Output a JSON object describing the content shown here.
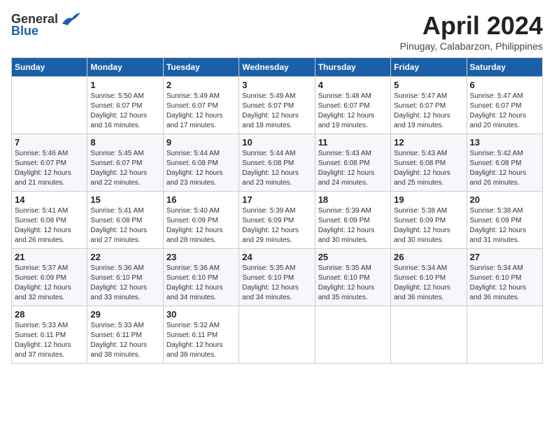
{
  "header": {
    "logo_general": "General",
    "logo_blue": "Blue",
    "month_title": "April 2024",
    "location": "Pinugay, Calabarzon, Philippines"
  },
  "weekdays": [
    "Sunday",
    "Monday",
    "Tuesday",
    "Wednesday",
    "Thursday",
    "Friday",
    "Saturday"
  ],
  "weeks": [
    [
      {
        "day": "",
        "sunrise": "",
        "sunset": "",
        "daylight": ""
      },
      {
        "day": "1",
        "sunrise": "Sunrise: 5:50 AM",
        "sunset": "Sunset: 6:07 PM",
        "daylight": "Daylight: 12 hours and 16 minutes."
      },
      {
        "day": "2",
        "sunrise": "Sunrise: 5:49 AM",
        "sunset": "Sunset: 6:07 PM",
        "daylight": "Daylight: 12 hours and 17 minutes."
      },
      {
        "day": "3",
        "sunrise": "Sunrise: 5:49 AM",
        "sunset": "Sunset: 6:07 PM",
        "daylight": "Daylight: 12 hours and 18 minutes."
      },
      {
        "day": "4",
        "sunrise": "Sunrise: 5:48 AM",
        "sunset": "Sunset: 6:07 PM",
        "daylight": "Daylight: 12 hours and 19 minutes."
      },
      {
        "day": "5",
        "sunrise": "Sunrise: 5:47 AM",
        "sunset": "Sunset: 6:07 PM",
        "daylight": "Daylight: 12 hours and 19 minutes."
      },
      {
        "day": "6",
        "sunrise": "Sunrise: 5:47 AM",
        "sunset": "Sunset: 6:07 PM",
        "daylight": "Daylight: 12 hours and 20 minutes."
      }
    ],
    [
      {
        "day": "7",
        "sunrise": "Sunrise: 5:46 AM",
        "sunset": "Sunset: 6:07 PM",
        "daylight": "Daylight: 12 hours and 21 minutes."
      },
      {
        "day": "8",
        "sunrise": "Sunrise: 5:45 AM",
        "sunset": "Sunset: 6:07 PM",
        "daylight": "Daylight: 12 hours and 22 minutes."
      },
      {
        "day": "9",
        "sunrise": "Sunrise: 5:44 AM",
        "sunset": "Sunset: 6:08 PM",
        "daylight": "Daylight: 12 hours and 23 minutes."
      },
      {
        "day": "10",
        "sunrise": "Sunrise: 5:44 AM",
        "sunset": "Sunset: 6:08 PM",
        "daylight": "Daylight: 12 hours and 23 minutes."
      },
      {
        "day": "11",
        "sunrise": "Sunrise: 5:43 AM",
        "sunset": "Sunset: 6:08 PM",
        "daylight": "Daylight: 12 hours and 24 minutes."
      },
      {
        "day": "12",
        "sunrise": "Sunrise: 5:43 AM",
        "sunset": "Sunset: 6:08 PM",
        "daylight": "Daylight: 12 hours and 25 minutes."
      },
      {
        "day": "13",
        "sunrise": "Sunrise: 5:42 AM",
        "sunset": "Sunset: 6:08 PM",
        "daylight": "Daylight: 12 hours and 26 minutes."
      }
    ],
    [
      {
        "day": "14",
        "sunrise": "Sunrise: 5:41 AM",
        "sunset": "Sunset: 6:08 PM",
        "daylight": "Daylight: 12 hours and 26 minutes."
      },
      {
        "day": "15",
        "sunrise": "Sunrise: 5:41 AM",
        "sunset": "Sunset: 6:08 PM",
        "daylight": "Daylight: 12 hours and 27 minutes."
      },
      {
        "day": "16",
        "sunrise": "Sunrise: 5:40 AM",
        "sunset": "Sunset: 6:09 PM",
        "daylight": "Daylight: 12 hours and 28 minutes."
      },
      {
        "day": "17",
        "sunrise": "Sunrise: 5:39 AM",
        "sunset": "Sunset: 6:09 PM",
        "daylight": "Daylight: 12 hours and 29 minutes."
      },
      {
        "day": "18",
        "sunrise": "Sunrise: 5:39 AM",
        "sunset": "Sunset: 6:09 PM",
        "daylight": "Daylight: 12 hours and 30 minutes."
      },
      {
        "day": "19",
        "sunrise": "Sunrise: 5:38 AM",
        "sunset": "Sunset: 6:09 PM",
        "daylight": "Daylight: 12 hours and 30 minutes."
      },
      {
        "day": "20",
        "sunrise": "Sunrise: 5:38 AM",
        "sunset": "Sunset: 6:09 PM",
        "daylight": "Daylight: 12 hours and 31 minutes."
      }
    ],
    [
      {
        "day": "21",
        "sunrise": "Sunrise: 5:37 AM",
        "sunset": "Sunset: 6:09 PM",
        "daylight": "Daylight: 12 hours and 32 minutes."
      },
      {
        "day": "22",
        "sunrise": "Sunrise: 5:36 AM",
        "sunset": "Sunset: 6:10 PM",
        "daylight": "Daylight: 12 hours and 33 minutes."
      },
      {
        "day": "23",
        "sunrise": "Sunrise: 5:36 AM",
        "sunset": "Sunset: 6:10 PM",
        "daylight": "Daylight: 12 hours and 34 minutes."
      },
      {
        "day": "24",
        "sunrise": "Sunrise: 5:35 AM",
        "sunset": "Sunset: 6:10 PM",
        "daylight": "Daylight: 12 hours and 34 minutes."
      },
      {
        "day": "25",
        "sunrise": "Sunrise: 5:35 AM",
        "sunset": "Sunset: 6:10 PM",
        "daylight": "Daylight: 12 hours and 35 minutes."
      },
      {
        "day": "26",
        "sunrise": "Sunrise: 5:34 AM",
        "sunset": "Sunset: 6:10 PM",
        "daylight": "Daylight: 12 hours and 36 minutes."
      },
      {
        "day": "27",
        "sunrise": "Sunrise: 5:34 AM",
        "sunset": "Sunset: 6:10 PM",
        "daylight": "Daylight: 12 hours and 36 minutes."
      }
    ],
    [
      {
        "day": "28",
        "sunrise": "Sunrise: 5:33 AM",
        "sunset": "Sunset: 6:11 PM",
        "daylight": "Daylight: 12 hours and 37 minutes."
      },
      {
        "day": "29",
        "sunrise": "Sunrise: 5:33 AM",
        "sunset": "Sunset: 6:11 PM",
        "daylight": "Daylight: 12 hours and 38 minutes."
      },
      {
        "day": "30",
        "sunrise": "Sunrise: 5:32 AM",
        "sunset": "Sunset: 6:11 PM",
        "daylight": "Daylight: 12 hours and 38 minutes."
      },
      {
        "day": "",
        "sunrise": "",
        "sunset": "",
        "daylight": ""
      },
      {
        "day": "",
        "sunrise": "",
        "sunset": "",
        "daylight": ""
      },
      {
        "day": "",
        "sunrise": "",
        "sunset": "",
        "daylight": ""
      },
      {
        "day": "",
        "sunrise": "",
        "sunset": "",
        "daylight": ""
      }
    ]
  ]
}
